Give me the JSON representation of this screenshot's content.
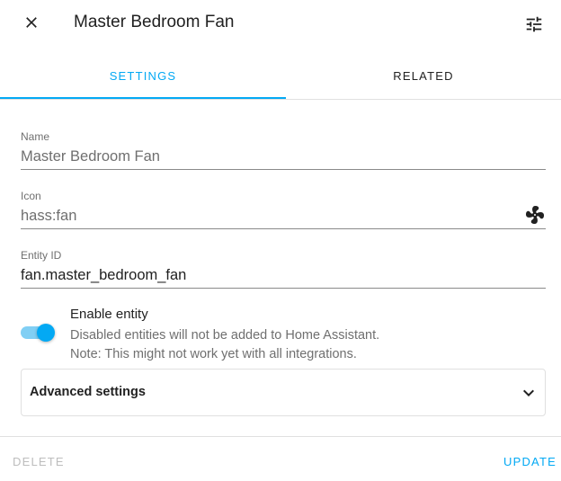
{
  "header": {
    "title": "Master Bedroom Fan",
    "close_icon": "close-icon",
    "tune_icon": "tune-icon"
  },
  "tabs": [
    {
      "label": "SETTINGS",
      "active": true
    },
    {
      "label": "RELATED",
      "active": false
    }
  ],
  "form": {
    "name": {
      "label": "Name",
      "value": "Master Bedroom Fan"
    },
    "icon": {
      "label": "Icon",
      "value": "hass:fan",
      "icon": "fan-icon"
    },
    "entity_id": {
      "label": "Entity ID",
      "value": "fan.master_bedroom_fan"
    },
    "enable": {
      "enabled": true,
      "title": "Enable entity",
      "desc_line1": "Disabled entities will not be added to Home Assistant.",
      "desc_line2": "Note: This might not work yet with all integrations."
    },
    "advanced": {
      "label": "Advanced settings",
      "expanded": false
    }
  },
  "footer": {
    "delete_label": "DELETE",
    "update_label": "UPDATE"
  },
  "colors": {
    "accent": "#03a9f4",
    "disabled": "#bdbdbd",
    "secondary_text": "#6f6f6f",
    "primary_text": "#212121"
  }
}
